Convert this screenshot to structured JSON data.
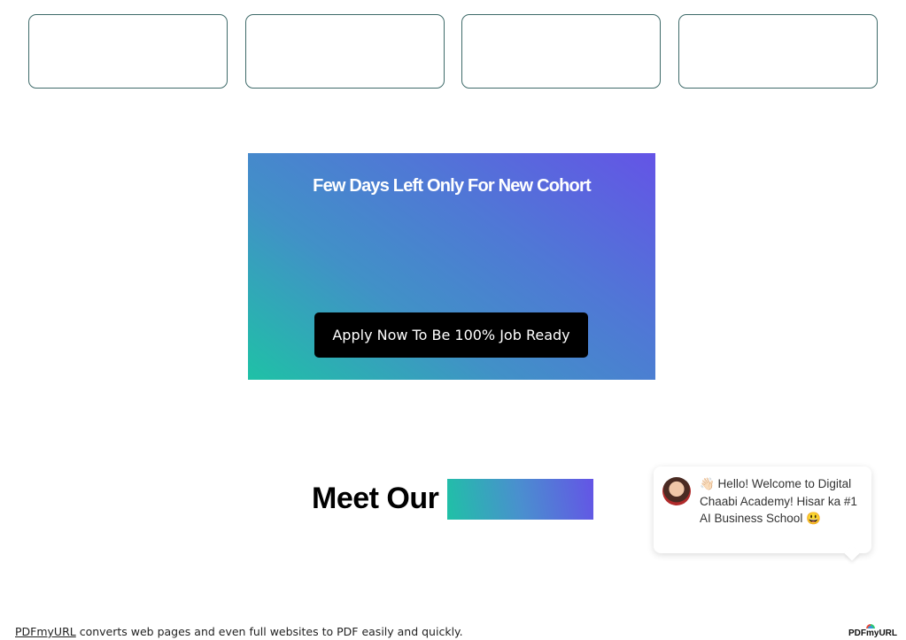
{
  "stat_cards": [
    {},
    {},
    {},
    {}
  ],
  "banner": {
    "title": "Few Days Left Only For New Cohort",
    "cta_label": "Apply Now To Be 100% Job Ready"
  },
  "meet": {
    "heading": "Meet Our"
  },
  "chat": {
    "message": "👋🏻 Hello! Welcome to Digital Chaabi Academy! Hisar ka #1 AI Business School 😃"
  },
  "footer": {
    "link_text": "PDFmyURL",
    "text": " converts web pages and even full websites to PDF easily and quickly.",
    "logo_text": "PDFmyURL"
  },
  "colors": {
    "card_border": "#3f6b6a",
    "gradient_start": "#1fc1a6",
    "gradient_end": "#6454e6",
    "button_bg": "#000000"
  }
}
